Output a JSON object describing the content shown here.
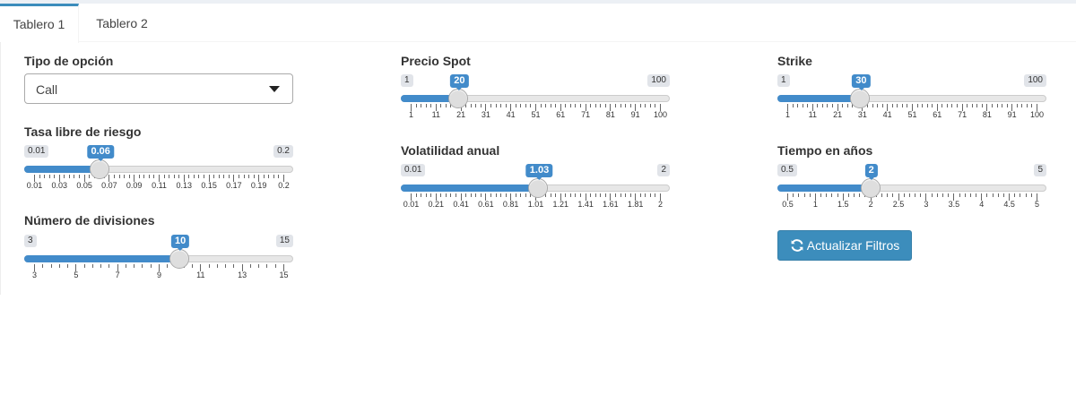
{
  "tabs": [
    {
      "label": "Tablero 1",
      "active": true
    },
    {
      "label": "Tablero 2",
      "active": false
    }
  ],
  "option_type": {
    "label": "Tipo de opción",
    "value": "Call"
  },
  "sliders": [
    {
      "id": "rate",
      "label": "Tasa libre de riesgo",
      "min_label": "0.01",
      "max_label": "0.2",
      "value_label": "0.06",
      "value": 0.06,
      "min": 0.01,
      "max": 0.2,
      "ticks": [
        "0.01",
        "0.03",
        "0.05",
        "0.07",
        "0.09",
        "0.11",
        "0.13",
        "0.15",
        "0.17",
        "0.19",
        "0.2"
      ]
    },
    {
      "id": "divisions",
      "label": "Número de divisiones",
      "min_label": "3",
      "max_label": "15",
      "value_label": "10",
      "value": 10,
      "min": 3,
      "max": 15,
      "ticks": [
        "3",
        "5",
        "7",
        "9",
        "11",
        "13",
        "15"
      ]
    },
    {
      "id": "spot",
      "label": "Precio Spot",
      "min_label": "1",
      "max_label": "100",
      "value_label": "20",
      "value": 20,
      "min": 1,
      "max": 100,
      "ticks": [
        "1",
        "11",
        "21",
        "31",
        "41",
        "51",
        "61",
        "71",
        "81",
        "91",
        "100"
      ]
    },
    {
      "id": "volatility",
      "label": "Volatilidad anual",
      "min_label": "0.01",
      "max_label": "2",
      "value_label": "1.03",
      "value": 1.03,
      "min": 0.01,
      "max": 2,
      "ticks": [
        "0.01",
        "0.21",
        "0.41",
        "0.61",
        "0.81",
        "1.01",
        "1.21",
        "1.41",
        "1.61",
        "1.81",
        "2"
      ]
    },
    {
      "id": "strike",
      "label": "Strike",
      "min_label": "1",
      "max_label": "100",
      "value_label": "30",
      "value": 30,
      "min": 1,
      "max": 100,
      "ticks": [
        "1",
        "11",
        "21",
        "31",
        "41",
        "51",
        "61",
        "71",
        "81",
        "91",
        "100"
      ]
    },
    {
      "id": "time",
      "label": "Tiempo en años",
      "min_label": "0.5",
      "max_label": "5",
      "value_label": "2",
      "value": 2,
      "min": 0.5,
      "max": 5,
      "ticks": [
        "0.5",
        "1",
        "1.5",
        "2",
        "2.5",
        "3",
        "3.5",
        "4",
        "4.5",
        "5"
      ]
    }
  ],
  "update_button": {
    "label": "Actualizar Filtros",
    "icon": "refresh-icon"
  },
  "colors": {
    "accent": "#3c8dbc",
    "slider_bar": "#428bca",
    "tab_border": "#3c8dbc"
  }
}
